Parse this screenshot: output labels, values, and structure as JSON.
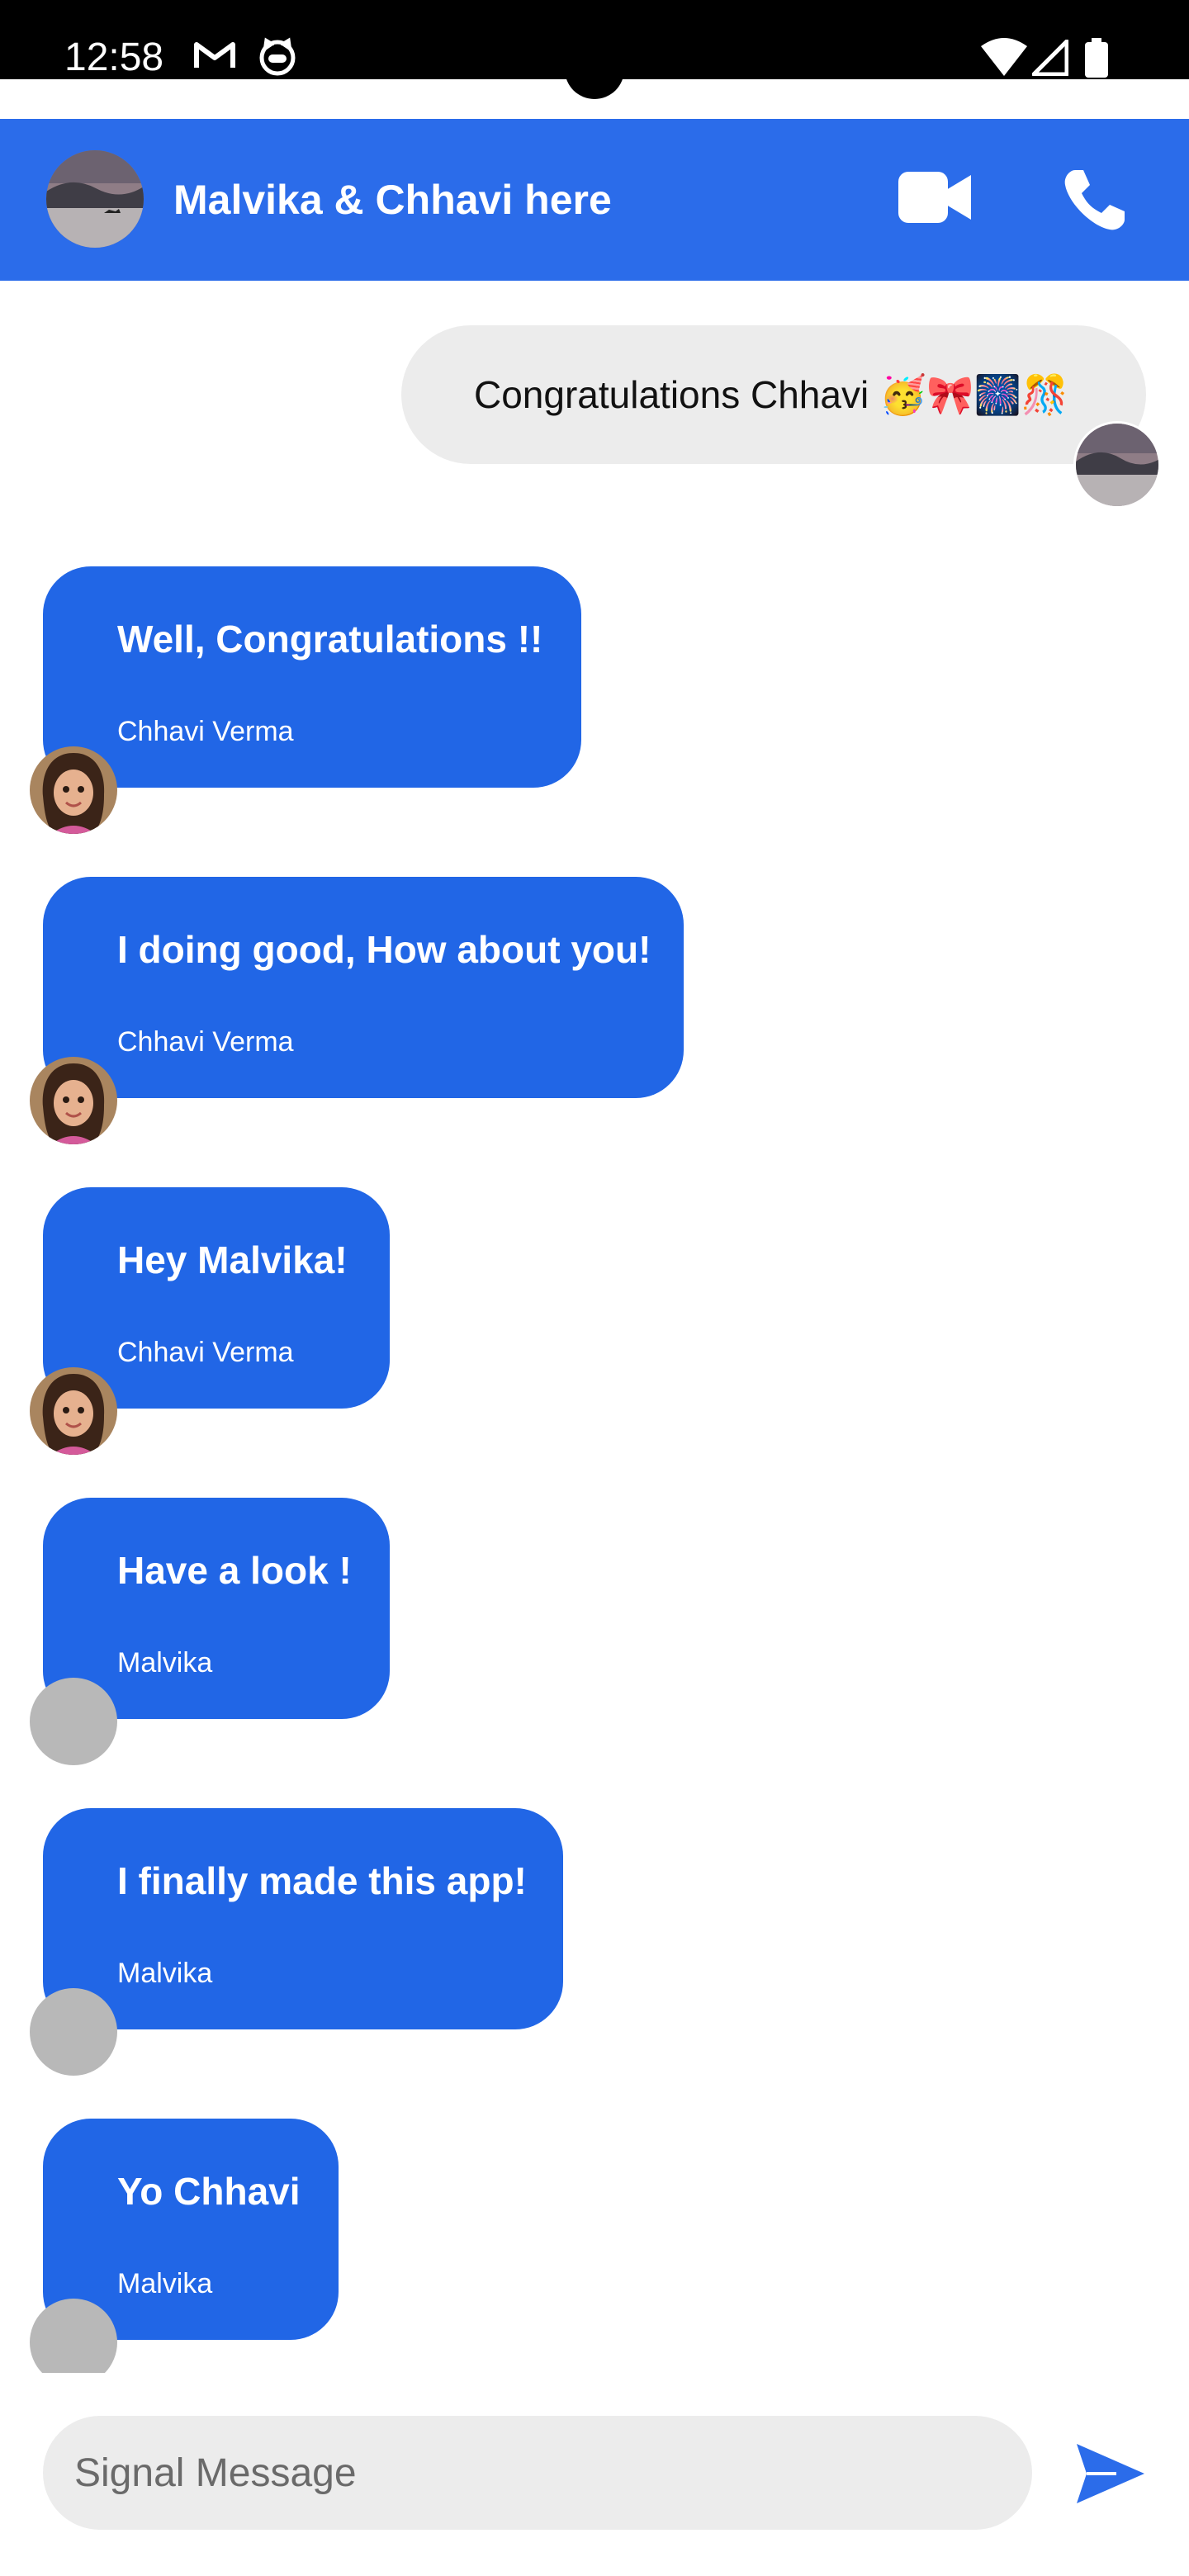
{
  "status_bar": {
    "time": "12:58",
    "icons": [
      "gmail-icon",
      "cat-face-icon",
      "wifi-icon",
      "signal-icon",
      "battery-icon"
    ]
  },
  "header": {
    "title": "Malvika & Chhavi here",
    "actions": [
      "video-call-icon",
      "phone-call-icon"
    ]
  },
  "messages": {
    "sent": {
      "text": "Congratulations Chhavi 🥳🎀🎆🎊"
    },
    "received": [
      {
        "text": "Well, Congratulations !!",
        "sender": "Chhavi Verma",
        "avatar": "cartoon-girl-avatar"
      },
      {
        "text": "I doing good, How about you!",
        "sender": "Chhavi Verma",
        "avatar": "cartoon-girl-avatar"
      },
      {
        "text": "Hey Malvika!",
        "sender": "Chhavi Verma",
        "avatar": "cartoon-girl-avatar"
      },
      {
        "text": "Have a look !",
        "sender": "Malvika",
        "avatar": "placeholder-avatar"
      },
      {
        "text": "I finally made this app!",
        "sender": "Malvika",
        "avatar": "placeholder-avatar"
      },
      {
        "text": "Yo Chhavi",
        "sender": "Malvika",
        "avatar": "placeholder-avatar"
      }
    ]
  },
  "composer": {
    "placeholder": "Signal Message",
    "send_icon": "send-icon"
  },
  "colors": {
    "app_bar": "#2b6cea",
    "received_bubble": "#2166e6",
    "sent_bubble": "#ececec",
    "status_bar": "#000000"
  }
}
